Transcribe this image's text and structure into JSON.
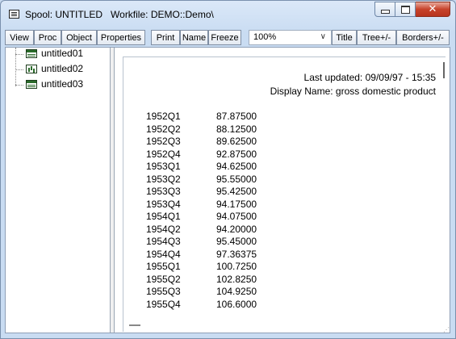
{
  "window": {
    "title": "Spool: UNTITLED   Workfile: DEMO::Demo\\",
    "buttons": {
      "minimize": "minimize",
      "maximize": "maximize",
      "close": "✕"
    }
  },
  "toolbar": {
    "buttons": [
      "View",
      "Proc",
      "Object",
      "Properties",
      "Print",
      "Name",
      "Freeze",
      "Title",
      "Tree+/-",
      "Borders+/-"
    ],
    "zoom": {
      "value": "100%"
    }
  },
  "tree": {
    "items": [
      {
        "label": "untitled01",
        "icon": "table-icon"
      },
      {
        "label": "untitled02",
        "icon": "graph-icon"
      },
      {
        "label": "untitled03",
        "icon": "table-icon"
      }
    ]
  },
  "table": {
    "header": {
      "last_updated": "Last updated: 09/09/97 - 15:35",
      "display_name": "Display Name: gross domestic product"
    },
    "rows": [
      {
        "period": "1952Q1",
        "value": "87.87500"
      },
      {
        "period": "1952Q2",
        "value": "88.12500"
      },
      {
        "period": "1952Q3",
        "value": "89.62500"
      },
      {
        "period": "1952Q4",
        "value": "92.87500"
      },
      {
        "period": "1953Q1",
        "value": "94.62500"
      },
      {
        "period": "1953Q2",
        "value": "95.55000"
      },
      {
        "period": "1953Q3",
        "value": "95.42500"
      },
      {
        "period": "1953Q4",
        "value": "94.17500"
      },
      {
        "period": "1954Q1",
        "value": "94.07500"
      },
      {
        "period": "1954Q2",
        "value": "94.20000"
      },
      {
        "period": "1954Q3",
        "value": "95.45000"
      },
      {
        "period": "1954Q4",
        "value": "97.36375"
      },
      {
        "period": "1955Q1",
        "value": "100.7250"
      },
      {
        "period": "1955Q2",
        "value": "102.8250"
      },
      {
        "period": "1955Q3",
        "value": "104.9250"
      },
      {
        "period": "1955Q4",
        "value": "106.6000"
      }
    ]
  }
}
